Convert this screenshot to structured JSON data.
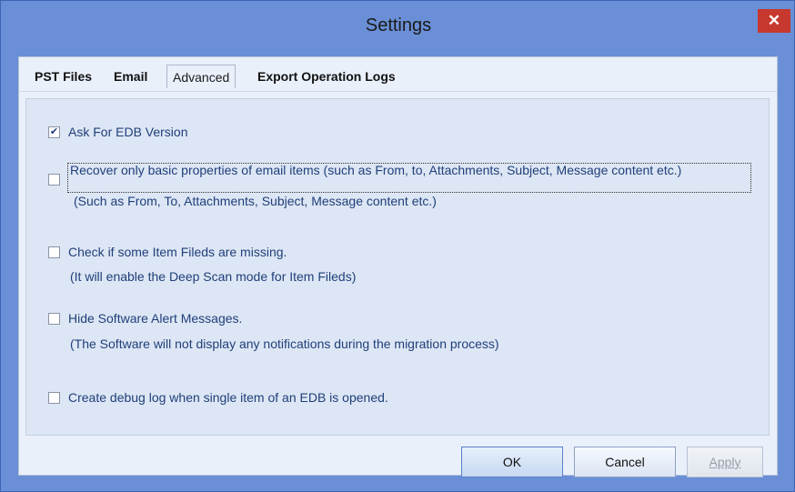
{
  "window": {
    "title": "Settings",
    "close_glyph": "✕"
  },
  "tabs": [
    {
      "label": "PST Files",
      "active": false
    },
    {
      "label": "Email",
      "active": false
    },
    {
      "label": "Advanced",
      "active": true
    },
    {
      "label": "Export Operation Logs",
      "active": false
    }
  ],
  "options": [
    {
      "label": "Ask For EDB Version",
      "checked": true,
      "note": ""
    },
    {
      "label": "Recover only basic properties of email items (such as From, to, Attachments, Subject, Message content etc.)",
      "checked": false,
      "note": "(Such as From, To, Attachments, Subject, Message content etc.)"
    },
    {
      "label": "Check if some Item Fileds are missing.",
      "checked": false,
      "note": "(It will enable the Deep Scan mode for Item Fileds)"
    },
    {
      "label": "Hide Software Alert Messages.",
      "checked": false,
      "note": "(The Software will not display any notifications during the migration process)"
    },
    {
      "label": "Create debug log when single item of an EDB is opened.",
      "checked": false,
      "note": ""
    }
  ],
  "buttons": {
    "ok": "OK",
    "cancel": "Cancel",
    "apply": "Apply"
  },
  "check_glyph": "✔"
}
